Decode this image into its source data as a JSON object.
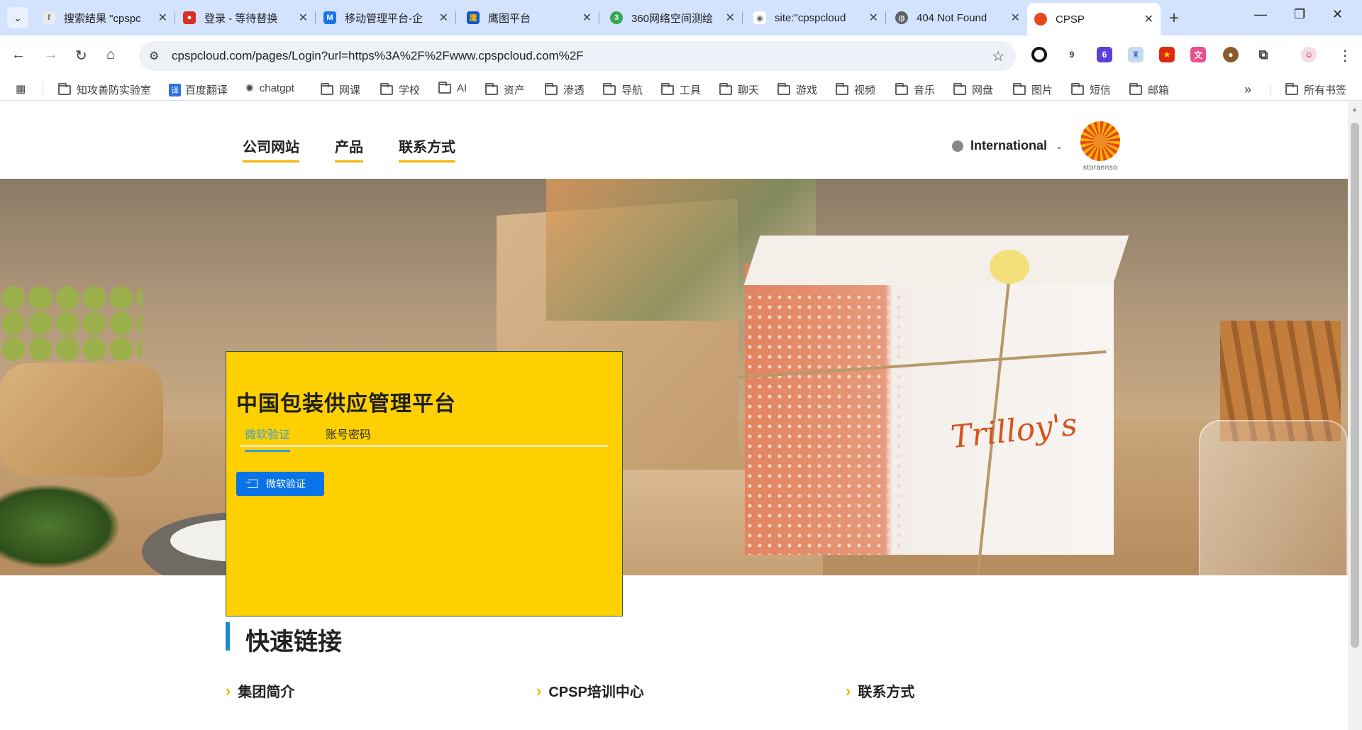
{
  "browser": {
    "tabs": [
      {
        "title": "搜索结果 \"cpspc",
        "favicon": "search-favicon",
        "color": "#5f6368",
        "active": false
      },
      {
        "title": "登录 - 等待替换",
        "favicon": "red-favicon",
        "color": "#d93025",
        "active": false
      },
      {
        "title": "移动管理平台-企",
        "favicon": "m-favicon",
        "color": "#1a73e8",
        "active": false
      },
      {
        "title": "鹰图平台",
        "favicon": "eagle-favicon",
        "color": "#0b57d0",
        "active": false
      },
      {
        "title": "360网络空间测绘",
        "favicon": "360-favicon",
        "color": "#34a853",
        "active": false
      },
      {
        "title": "site:\"cpspcloud",
        "favicon": "eye-favicon",
        "color": "#5f6368",
        "active": false
      },
      {
        "title": "404 Not Found",
        "favicon": "globe-favicon",
        "color": "#5f6368",
        "active": false
      },
      {
        "title": "CPSP",
        "favicon": "cpsp-favicon",
        "color": "#e8471b",
        "active": true
      }
    ],
    "url": "cpspcloud.com/pages/Login?url=https%3A%2F%2Fwww.cpspcloud.com%2F",
    "extension_badges": {
      "ext2": "9",
      "ext3": "6"
    },
    "bookmarks": [
      {
        "label": "知攻善防实验室",
        "type": "folder"
      },
      {
        "label": "百度翻译",
        "type": "link"
      },
      {
        "label": "chatgpt",
        "type": "link"
      },
      {
        "label": "网课",
        "type": "folder"
      },
      {
        "label": "学校",
        "type": "folder"
      },
      {
        "label": "AI",
        "type": "folder"
      },
      {
        "label": "资产",
        "type": "folder"
      },
      {
        "label": "渗透",
        "type": "folder"
      },
      {
        "label": "导航",
        "type": "folder"
      },
      {
        "label": "工具",
        "type": "folder"
      },
      {
        "label": "聊天",
        "type": "folder"
      },
      {
        "label": "游戏",
        "type": "folder"
      },
      {
        "label": "视频",
        "type": "folder"
      },
      {
        "label": "音乐",
        "type": "folder"
      },
      {
        "label": "网盘",
        "type": "folder"
      },
      {
        "label": "图片",
        "type": "folder"
      },
      {
        "label": "短信",
        "type": "folder"
      },
      {
        "label": "邮箱",
        "type": "folder"
      }
    ],
    "all_bookmarks": "所有书签"
  },
  "site": {
    "nav": [
      "公司网站",
      "产品",
      "联系方式"
    ],
    "language": "International",
    "logo_text": "storaenso",
    "accent": "#f5b400",
    "hero_product_text": "Trilloy's",
    "login": {
      "heading": "中国包装供应管理平台",
      "tab_active": "微软验证",
      "tab_inactive": "账号密码",
      "ms_button": "微软验证",
      "card_color": "#ffd000",
      "button_color": "#0a73e8"
    },
    "quick_links": {
      "title": "快速链接",
      "items": [
        "集团简介",
        "CPSP培训中心",
        "联系方式"
      ]
    }
  }
}
